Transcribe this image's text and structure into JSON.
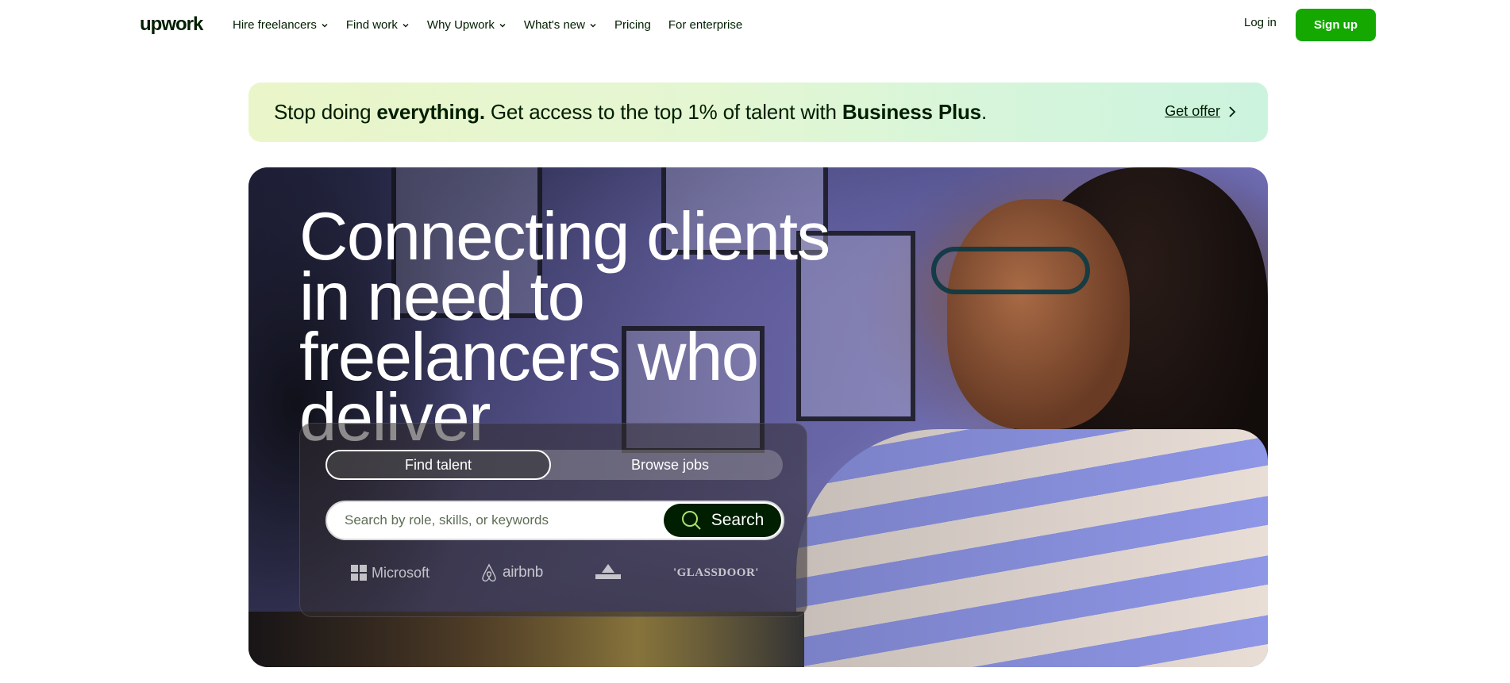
{
  "nav": {
    "logo_text": "upwork",
    "links": [
      {
        "label": "Hire freelancers",
        "dropdown": true
      },
      {
        "label": "Find work",
        "dropdown": true
      },
      {
        "label": "Why Upwork",
        "dropdown": true
      },
      {
        "label": "What's new",
        "dropdown": true
      },
      {
        "label": "Pricing",
        "dropdown": false
      },
      {
        "label": "For enterprise",
        "dropdown": false
      }
    ],
    "login_label": "Log in",
    "signup_label": "Sign up"
  },
  "banner": {
    "text_1": "Stop doing ",
    "text_bold_1": "everything.",
    "text_2": " Get access to the top 1% of talent with ",
    "text_bold_2": "Business Plus",
    "text_3": ".",
    "cta_label": "Get offer"
  },
  "hero": {
    "headline": "Connecting clients in need to freelancers who deliver",
    "tabs": {
      "find_talent": "Find talent",
      "browse_jobs": "Browse jobs"
    },
    "search": {
      "placeholder": "Search by role, skills, or keywords",
      "button_label": "Search"
    },
    "trusted_brands": {
      "microsoft": "Microsoft",
      "airbnb": "airbnb",
      "bissell": "BISSELL",
      "glassdoor": "'GLASSDOOR'"
    }
  },
  "colors": {
    "brand_green": "#14a800",
    "banner_gradient_start": "#eaf5c9",
    "banner_gradient_end": "#ccf3de",
    "search_button": "#001e00"
  },
  "icons": [
    "upwork-logo-icon",
    "chevron-down-icon",
    "chevron-right-icon",
    "search-icon",
    "microsoft-logo-icon",
    "airbnb-logo-icon",
    "bissell-logo-icon"
  ]
}
